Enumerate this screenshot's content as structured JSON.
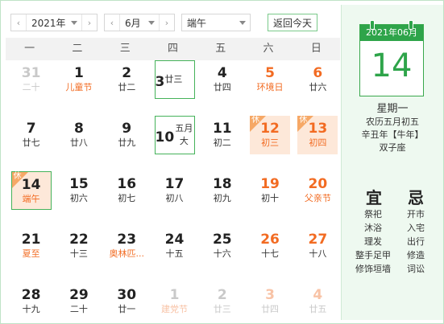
{
  "toolbar": {
    "year_value": "2021年",
    "month_value": "6月",
    "holiday_value": "端午",
    "today_label": "返回今天"
  },
  "weekdays": [
    "一",
    "二",
    "三",
    "四",
    "五",
    "六",
    "日"
  ],
  "days": [
    {
      "n": "31",
      "s": "二十",
      "other": true
    },
    {
      "n": "1",
      "s": "儿童节",
      "fest": true
    },
    {
      "n": "2",
      "s": "廿二"
    },
    {
      "n": "3",
      "s": "廿三",
      "sel": true
    },
    {
      "n": "4",
      "s": "廿四"
    },
    {
      "n": "5",
      "s": "环境日",
      "wk": true,
      "fest": true
    },
    {
      "n": "6",
      "s": "廿六",
      "wk": true
    },
    {
      "n": "7",
      "s": "廿七"
    },
    {
      "n": "8",
      "s": "廿八"
    },
    {
      "n": "9",
      "s": "廿九"
    },
    {
      "n": "10",
      "s": "五月大",
      "sel": true
    },
    {
      "n": "11",
      "s": "初二"
    },
    {
      "n": "12",
      "s": "初三",
      "wk": true,
      "holiday": true,
      "fest": true
    },
    {
      "n": "13",
      "s": "初四",
      "wk": true,
      "holiday": true,
      "fest": true
    },
    {
      "n": "14",
      "s": "端午",
      "today": true,
      "fest": true
    },
    {
      "n": "15",
      "s": "初六"
    },
    {
      "n": "16",
      "s": "初七"
    },
    {
      "n": "17",
      "s": "初八"
    },
    {
      "n": "18",
      "s": "初九"
    },
    {
      "n": "19",
      "s": "初十",
      "wk": true
    },
    {
      "n": "20",
      "s": "父亲节",
      "wk": true,
      "fest": true
    },
    {
      "n": "21",
      "s": "夏至",
      "fest": true
    },
    {
      "n": "22",
      "s": "十三"
    },
    {
      "n": "23",
      "s": "奥林匹...",
      "fest": true
    },
    {
      "n": "24",
      "s": "十五"
    },
    {
      "n": "25",
      "s": "十六"
    },
    {
      "n": "26",
      "s": "十七",
      "wk": true
    },
    {
      "n": "27",
      "s": "十八",
      "wk": true
    },
    {
      "n": "28",
      "s": "十九"
    },
    {
      "n": "29",
      "s": "二十"
    },
    {
      "n": "30",
      "s": "廿一"
    },
    {
      "n": "1",
      "s": "建党节",
      "other": true,
      "fest": true
    },
    {
      "n": "2",
      "s": "廿三",
      "other": true
    },
    {
      "n": "3",
      "s": "廿四",
      "other": true,
      "wk": true
    },
    {
      "n": "4",
      "s": "廿五",
      "other": true,
      "wk": true
    }
  ],
  "holiday_badge": "休",
  "panel": {
    "header": "2021年06月",
    "day": "14",
    "weekday": "星期一",
    "lunar": "农历五月初五",
    "ganzhi": "辛丑年【牛年】",
    "zodiac": "双子座",
    "yi_label": "宜",
    "ji_label": "忌",
    "yi": [
      "祭祀",
      "沐浴",
      "理发",
      "整手足甲",
      "修饰垣墙"
    ],
    "ji": [
      "开市",
      "入宅",
      "出行",
      "修造",
      "词讼"
    ]
  },
  "colors": {
    "accent": "#2ea44a",
    "weekend": "#f26b22",
    "holiday_bg": "#fde8d9"
  }
}
